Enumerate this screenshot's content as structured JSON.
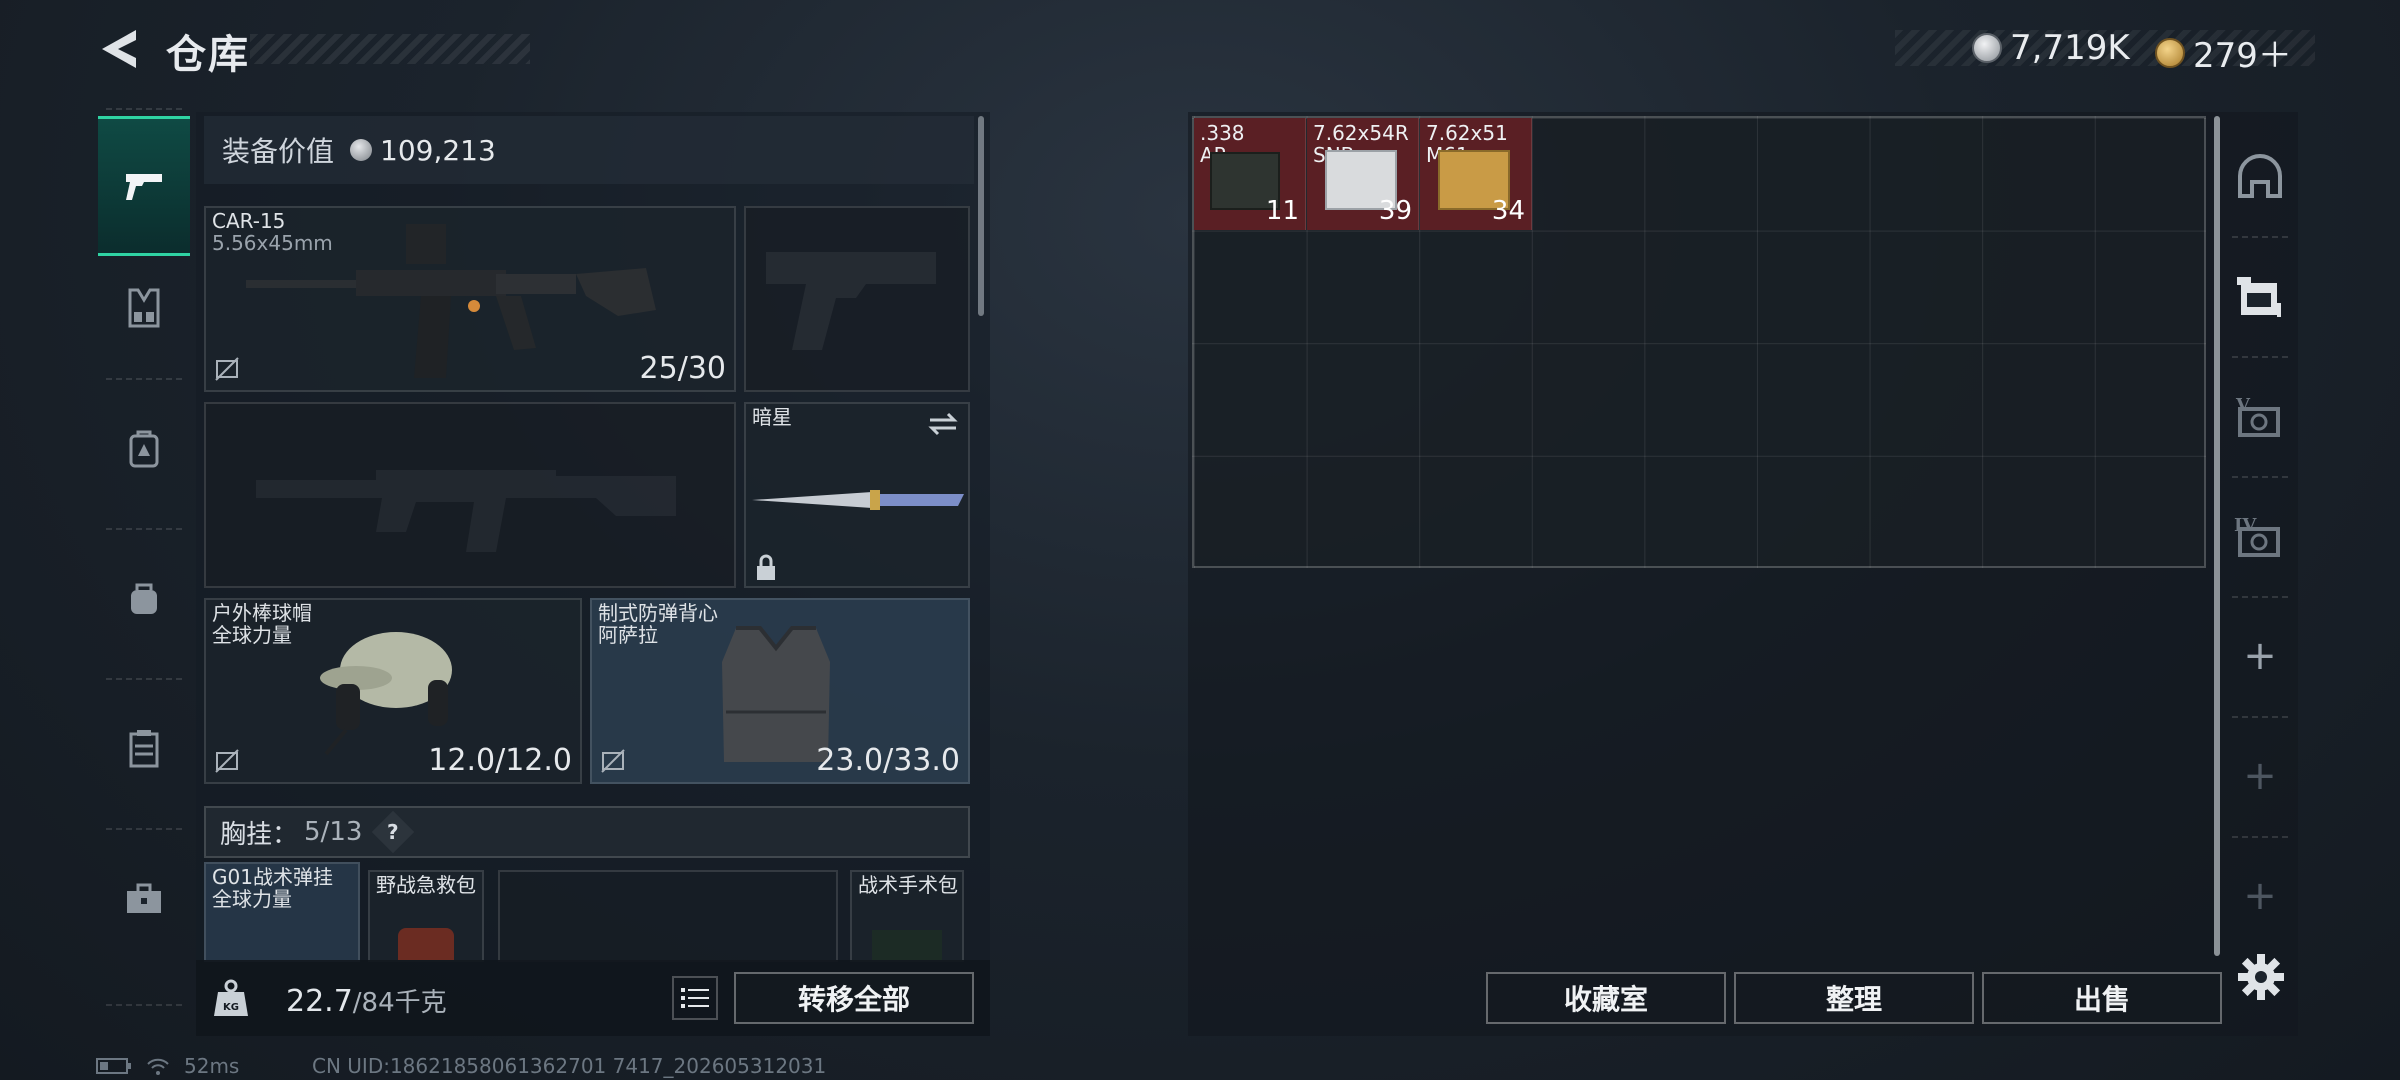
{
  "header": {
    "title": "仓库",
    "currency": [
      {
        "icon": "silver-coin-icon",
        "value": "7,719K"
      },
      {
        "icon": "gold-triangle-coin-icon",
        "value": "279＋"
      }
    ]
  },
  "left_nav": [
    {
      "icon": "pistol-icon",
      "active": true
    },
    {
      "icon": "chest-rig-icon",
      "active": false
    },
    {
      "icon": "backpack-icon",
      "active": false
    },
    {
      "icon": "bag-icon",
      "active": false
    },
    {
      "icon": "case-icon",
      "active": false
    },
    {
      "icon": "toolbox-icon",
      "active": false
    }
  ],
  "equipment": {
    "value_label": "装备价值",
    "value": "109,213",
    "primary_weapon": {
      "name": "CAR-15",
      "caliber": "5.56x45mm",
      "ammo": "25/30"
    },
    "melee": {
      "name": "暗星"
    },
    "helmet": {
      "name": "户外棒球帽",
      "faction": "全球力量",
      "durability": "12.0/12.0"
    },
    "armor": {
      "name": "制式防弹背心",
      "faction": "阿萨拉",
      "durability": "23.0/33.0"
    },
    "chest_rig": {
      "label": "胸挂：",
      "capacity": "5/13",
      "help": "?"
    },
    "rig_items": [
      {
        "name": "G01战术弹挂",
        "sub": "全球力量"
      },
      {
        "name": "野战急救包"
      },
      {
        "name": "战术手术包"
      }
    ]
  },
  "weight": {
    "current": "22.7",
    "max": "/84千克"
  },
  "transfer_all_label": "转移全部",
  "stash": {
    "items": [
      {
        "line1": ".338",
        "line2": "AP",
        "count": "11"
      },
      {
        "line1": "7.62x54R",
        "line2": "SNB",
        "count": "39"
      },
      {
        "line1": "7.62x51",
        "line2": "M61",
        "count": "34"
      }
    ]
  },
  "right_nav": [
    {
      "icon": "safe-dome-icon"
    },
    {
      "icon": "stash-shelf-icon"
    },
    {
      "icon": "stash-v-icon",
      "roman": "V"
    },
    {
      "icon": "stash-iv-icon",
      "roman": "IV"
    },
    {
      "icon": "plus-icon"
    },
    {
      "icon": "plus-icon"
    },
    {
      "icon": "plus-icon"
    }
  ],
  "buttons": {
    "collect": "收藏室",
    "sort": "整理",
    "sell": "出售"
  },
  "status": {
    "ping": "52ms",
    "uid": "CN UID:18621858061362701 7417_202605312031"
  }
}
